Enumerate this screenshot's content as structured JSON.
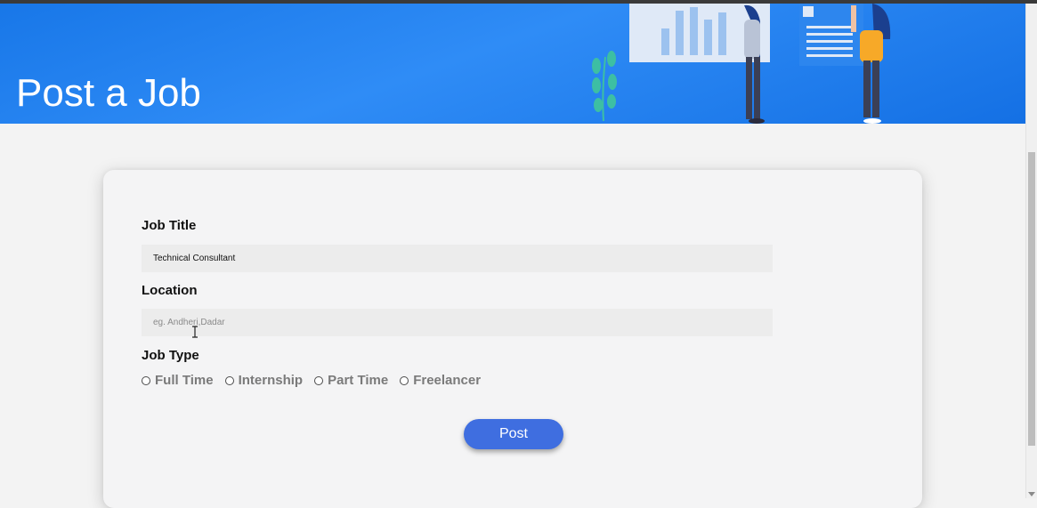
{
  "banner": {
    "title": "Post a Job",
    "illustration": "people-reviewing-charts-illustration",
    "background_color": "#1877e8"
  },
  "form": {
    "job_title": {
      "label": "Job Title",
      "value": "Technical Consultant",
      "placeholder": ""
    },
    "location": {
      "label": "Location",
      "value": "",
      "placeholder": "eg. Andheri,Dadar"
    },
    "job_type": {
      "label": "Job Type",
      "options": [
        {
          "label": "Full Time",
          "checked": false
        },
        {
          "label": "Internship",
          "checked": false
        },
        {
          "label": "Part Time",
          "checked": false
        },
        {
          "label": "Freelancer",
          "checked": false
        }
      ]
    },
    "submit_label": "Post",
    "submit_color": "#3f6ee0"
  },
  "cursor": {
    "icon": "i-beam-cursor-icon"
  }
}
